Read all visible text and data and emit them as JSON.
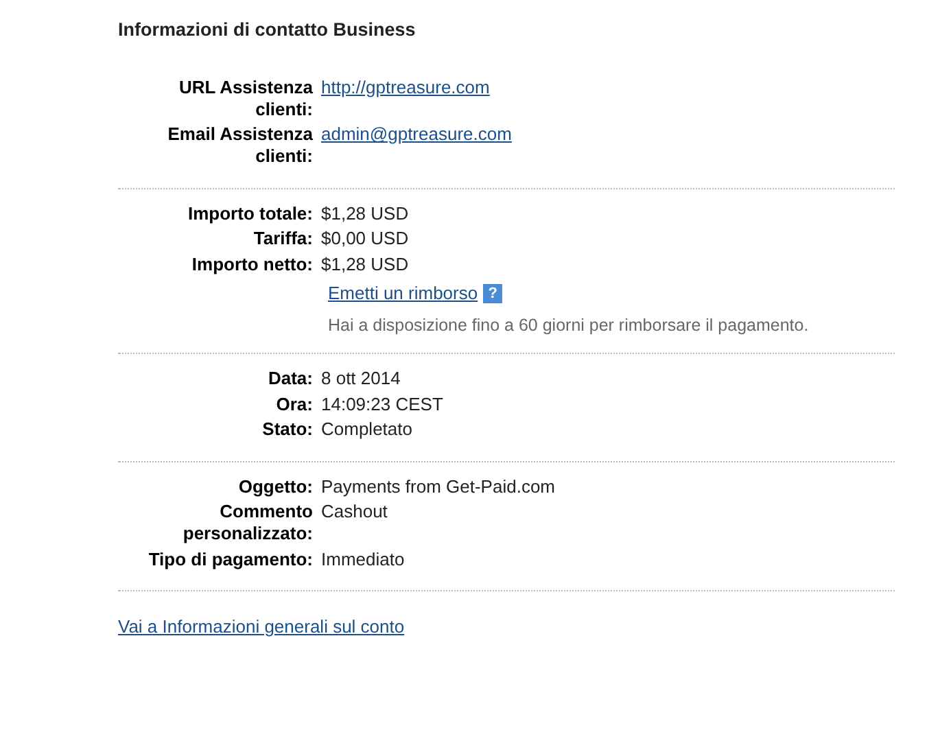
{
  "title": "Informazioni di contatto Business",
  "sections": [
    {
      "rows": [
        {
          "label": "URL Assistenza clienti:",
          "value": "http://gptreasure.com",
          "kind": "link"
        },
        {
          "label": "Email Assistenza clienti:",
          "value": "admin@gptreasure.com",
          "kind": "link"
        }
      ]
    },
    {
      "rows": [
        {
          "label": "Importo totale:",
          "value": "$1,28 USD",
          "kind": "text"
        },
        {
          "label": "Tariffa:",
          "value": "$0,00 USD",
          "kind": "text"
        },
        {
          "label": "Importo netto:",
          "value": "$1,28 USD",
          "kind": "text"
        }
      ],
      "refund": {
        "link": "Emetti un rimborso",
        "help": "?",
        "note": "Hai a disposizione fino a 60 giorni per rimborsare il pagamento."
      }
    },
    {
      "rows": [
        {
          "label": "Data:",
          "value": "8 ott 2014",
          "kind": "text"
        },
        {
          "label": "Ora:",
          "value": "14:09:23 CEST",
          "kind": "text"
        },
        {
          "label": "Stato:",
          "value": "Completato",
          "kind": "text"
        }
      ]
    },
    {
      "rows": [
        {
          "label": "Oggetto:",
          "value": "Payments from Get-Paid.com",
          "kind": "text"
        },
        {
          "label": "Commento personalizzato:",
          "value": "Cashout",
          "kind": "text"
        },
        {
          "label": "Tipo di pagamento:",
          "value": "Immediato",
          "kind": "text"
        }
      ]
    }
  ],
  "footer_link": "Vai a Informazioni generali sul conto"
}
